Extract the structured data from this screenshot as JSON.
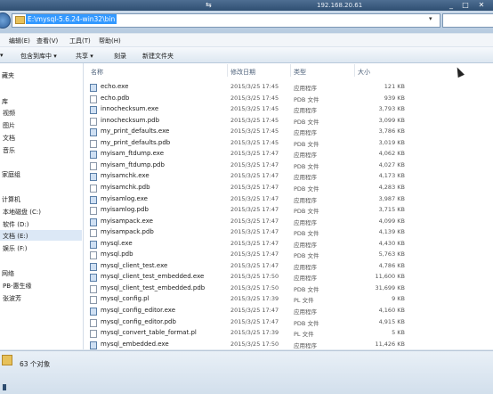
{
  "remote_title": "192.168.20.61",
  "remote_marker": "⇆",
  "window_controls": [
    "_",
    "□",
    "✕"
  ],
  "address": "E:\\mysql-5.6.24-win32\\bin",
  "menu": [
    "编辑(E)",
    "查看(V)",
    "工具(T)",
    "帮助(H)"
  ],
  "toolbar": [
    "包含到库中 ▾",
    "共享 ▾",
    "刻录",
    "新建文件夹"
  ],
  "nav_items": [
    "藏夹",
    "",
    "库",
    "视频",
    "图片",
    "文档",
    "音乐",
    "家庭组",
    "计算机",
    "本地磁盘 (C:)",
    "软件 (D:)",
    "文档 (E:)",
    "娱乐 (F:)",
    "网络",
    "PB-惠生缘",
    "张波芳"
  ],
  "columns": {
    "name": "名称",
    "date": "修改日期",
    "type": "类型",
    "size": "大小"
  },
  "files": [
    {
      "name": "echo.exe",
      "date": "2015/3/25 17:45",
      "type": "应用程序",
      "size": "121 KB",
      "icon": "exe-icon"
    },
    {
      "name": "echo.pdb",
      "date": "2015/3/25 17:45",
      "type": "PDB 文件",
      "size": "939 KB",
      "icon": "file-icon"
    },
    {
      "name": "innochecksum.exe",
      "date": "2015/3/25 17:45",
      "type": "应用程序",
      "size": "3,793 KB",
      "icon": "exe-icon"
    },
    {
      "name": "innochecksum.pdb",
      "date": "2015/3/25 17:45",
      "type": "PDB 文件",
      "size": "3,099 KB",
      "icon": "file-icon"
    },
    {
      "name": "my_print_defaults.exe",
      "date": "2015/3/25 17:45",
      "type": "应用程序",
      "size": "3,786 KB",
      "icon": "exe-icon"
    },
    {
      "name": "my_print_defaults.pdb",
      "date": "2015/3/25 17:45",
      "type": "PDB 文件",
      "size": "3,019 KB",
      "icon": "file-icon"
    },
    {
      "name": "myisam_ftdump.exe",
      "date": "2015/3/25 17:47",
      "type": "应用程序",
      "size": "4,062 KB",
      "icon": "exe-icon"
    },
    {
      "name": "myisam_ftdump.pdb",
      "date": "2015/3/25 17:47",
      "type": "PDB 文件",
      "size": "4,027 KB",
      "icon": "file-icon"
    },
    {
      "name": "myisamchk.exe",
      "date": "2015/3/25 17:47",
      "type": "应用程序",
      "size": "4,173 KB",
      "icon": "exe-icon"
    },
    {
      "name": "myisamchk.pdb",
      "date": "2015/3/25 17:47",
      "type": "PDB 文件",
      "size": "4,283 KB",
      "icon": "file-icon"
    },
    {
      "name": "myisamlog.exe",
      "date": "2015/3/25 17:47",
      "type": "应用程序",
      "size": "3,987 KB",
      "icon": "exe-icon"
    },
    {
      "name": "myisamlog.pdb",
      "date": "2015/3/25 17:47",
      "type": "PDB 文件",
      "size": "3,715 KB",
      "icon": "file-icon"
    },
    {
      "name": "myisampack.exe",
      "date": "2015/3/25 17:47",
      "type": "应用程序",
      "size": "4,099 KB",
      "icon": "exe-icon"
    },
    {
      "name": "myisampack.pdb",
      "date": "2015/3/25 17:47",
      "type": "PDB 文件",
      "size": "4,139 KB",
      "icon": "file-icon"
    },
    {
      "name": "mysql.exe",
      "date": "2015/3/25 17:47",
      "type": "应用程序",
      "size": "4,430 KB",
      "icon": "exe-icon"
    },
    {
      "name": "mysql.pdb",
      "date": "2015/3/25 17:47",
      "type": "PDB 文件",
      "size": "5,763 KB",
      "icon": "file-icon"
    },
    {
      "name": "mysql_client_test.exe",
      "date": "2015/3/25 17:47",
      "type": "应用程序",
      "size": "4,786 KB",
      "icon": "exe-icon"
    },
    {
      "name": "mysql_client_test_embedded.exe",
      "date": "2015/3/25 17:50",
      "type": "应用程序",
      "size": "11,600 KB",
      "icon": "exe-icon"
    },
    {
      "name": "mysql_client_test_embedded.pdb",
      "date": "2015/3/25 17:50",
      "type": "PDB 文件",
      "size": "31,699 KB",
      "icon": "file-icon"
    },
    {
      "name": "mysql_config.pl",
      "date": "2015/3/25 17:39",
      "type": "PL 文件",
      "size": "9 KB",
      "icon": "file-icon"
    },
    {
      "name": "mysql_config_editor.exe",
      "date": "2015/3/25 17:47",
      "type": "应用程序",
      "size": "4,160 KB",
      "icon": "exe-icon"
    },
    {
      "name": "mysql_config_editor.pdb",
      "date": "2015/3/25 17:47",
      "type": "PDB 文件",
      "size": "4,915 KB",
      "icon": "file-icon"
    },
    {
      "name": "mysql_convert_table_format.pl",
      "date": "2015/3/25 17:39",
      "type": "PL 文件",
      "size": "5 KB",
      "icon": "file-icon"
    },
    {
      "name": "mysql_embedded.exe",
      "date": "2015/3/25 17:50",
      "type": "应用程序",
      "size": "11,426 KB",
      "icon": "exe-icon"
    }
  ],
  "status": "63 个对象"
}
